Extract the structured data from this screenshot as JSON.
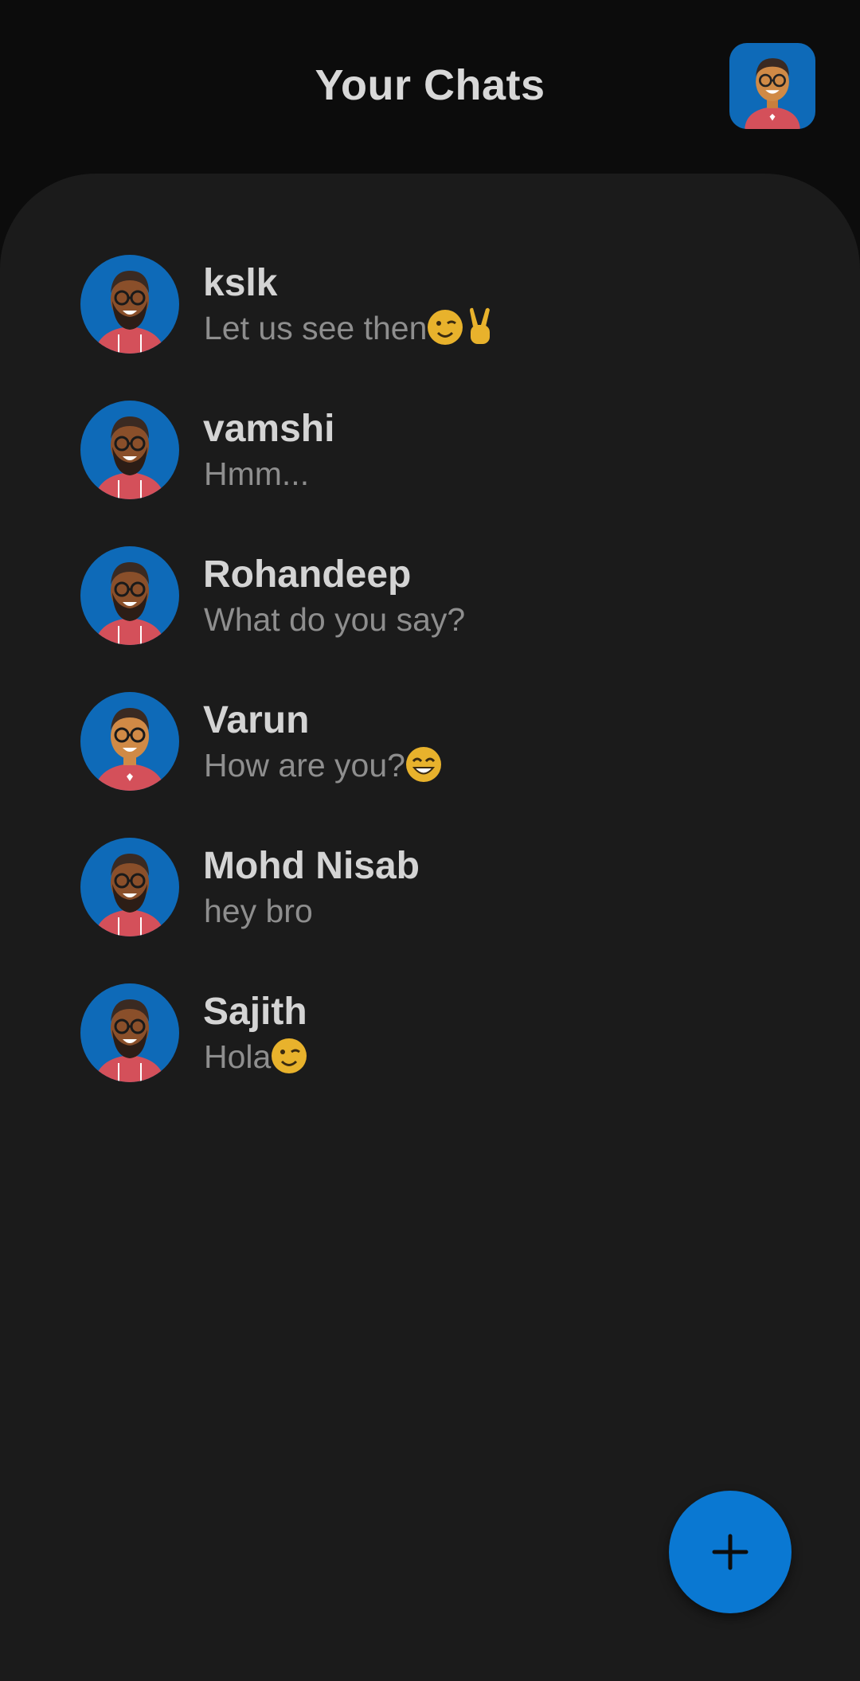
{
  "header": {
    "title": "Your Chats",
    "profile_icon": "user-avatar-icon"
  },
  "chats": [
    {
      "name": "kslk",
      "preview": "Let us see then",
      "emojis": [
        "wink",
        "victory"
      ],
      "avatar": "bearded-man"
    },
    {
      "name": "vamshi",
      "preview": "Hmm...",
      "emojis": [],
      "avatar": "bearded-man"
    },
    {
      "name": "Rohandeep",
      "preview": "What do you say?",
      "emojis": [],
      "avatar": "bearded-man"
    },
    {
      "name": "Varun",
      "preview": "How are you?",
      "emojis": [
        "grin"
      ],
      "avatar": "smiling-man"
    },
    {
      "name": "Mohd Nisab",
      "preview": "hey bro",
      "emojis": [],
      "avatar": "bearded-man"
    },
    {
      "name": "Sajith",
      "preview": "Hola",
      "emojis": [
        "wink"
      ],
      "avatar": "bearded-man"
    }
  ],
  "fab": {
    "icon": "plus-icon"
  },
  "colors": {
    "background": "#0c0c0c",
    "panel": "#1b1b1b",
    "accent": "#0a78d2",
    "avatar_bg": "#0e6ab8",
    "name_text": "#d4d4d4",
    "preview_text": "#8e8e8e"
  }
}
